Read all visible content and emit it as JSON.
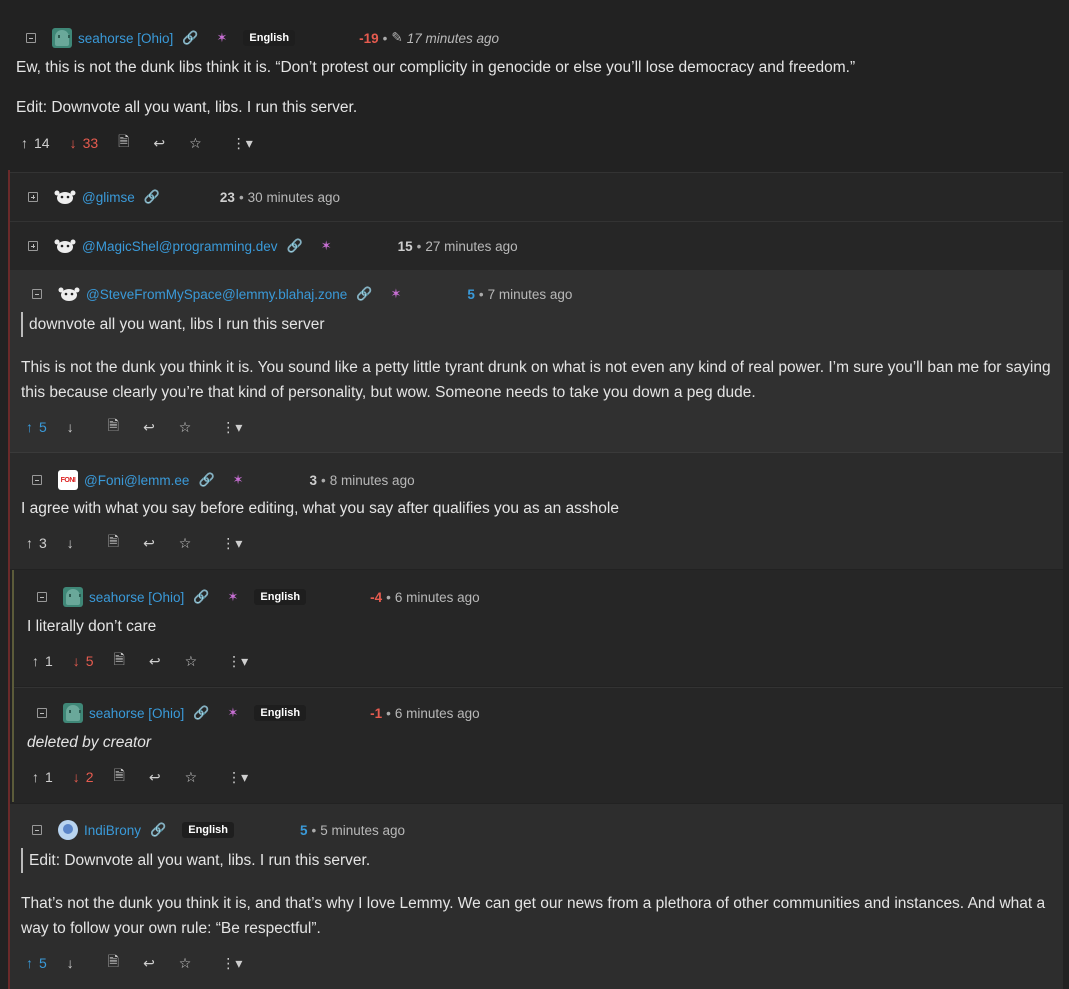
{
  "comments": {
    "c1": {
      "user": "seahorse [Ohio]",
      "lang": "English",
      "score": "-19",
      "time": "17 minutes ago",
      "p1": "Ew, this is not the dunk libs think it is. “Don’t protest our complicity in genocide or else you’ll lose democracy and freedom.”",
      "p2": "Edit: Downvote all you want, libs. I run this server.",
      "up": "14",
      "down": "33"
    },
    "c2": {
      "user": "@glimse",
      "score": "23",
      "time": "30 minutes ago"
    },
    "c3": {
      "user": "@MagicShel@programming.dev",
      "score": "15",
      "time": "27 minutes ago"
    },
    "c4": {
      "user": "@SteveFromMySpace@lemmy.blahaj.zone",
      "score": "5",
      "time": "7 minutes ago",
      "quote": "downvote all you want, libs I run this server",
      "p1": "This is not the dunk you think it is. You sound like a petty little tyrant drunk on what is not even any kind of real power. I’m sure you’ll ban me for saying this because clearly you’re that kind of personality, but wow. Someone needs to take you down a peg dude.",
      "up": "5"
    },
    "c5": {
      "user": "@Foni@lemm.ee",
      "score": "3",
      "time": "8 minutes ago",
      "p1": "I agree with what you say before editing, what you say after qualifies you as an asshole",
      "up": "3",
      "avatar_text": "FONI"
    },
    "c6": {
      "user": "seahorse [Ohio]",
      "lang": "English",
      "score": "-4",
      "time": "6 minutes ago",
      "p1": "I literally don’t care",
      "up": "1",
      "down": "5"
    },
    "c7": {
      "user": "seahorse [Ohio]",
      "lang": "English",
      "score": "-1",
      "time": "6 minutes ago",
      "p1": "deleted by creator",
      "up": "1",
      "down": "2"
    },
    "c8": {
      "user": "IndiBrony",
      "lang": "English",
      "score": "5",
      "time": "5 minutes ago",
      "quote": "Edit: Downvote all you want, libs. I run this server.",
      "p1": "That’s not the dunk you think it is, and that’s why I love Lemmy. We can get our news from a plethora of other communities and instances. And what a way to follow your own rule: “Be respectful”.",
      "up": "5"
    }
  },
  "icons": {
    "upvote": "↑",
    "downvote": "↓",
    "link": "🔗",
    "source": "🗎",
    "reply": "↩",
    "save": "☆",
    "more": "⋮▾",
    "edit": "✎",
    "instance_star": "✶"
  },
  "colors": {
    "background": "#222222",
    "username": "#3a9ad9",
    "negative": "#e65b4f",
    "positive": "#3a9ad9",
    "thread_line": "#6b2a2a"
  }
}
